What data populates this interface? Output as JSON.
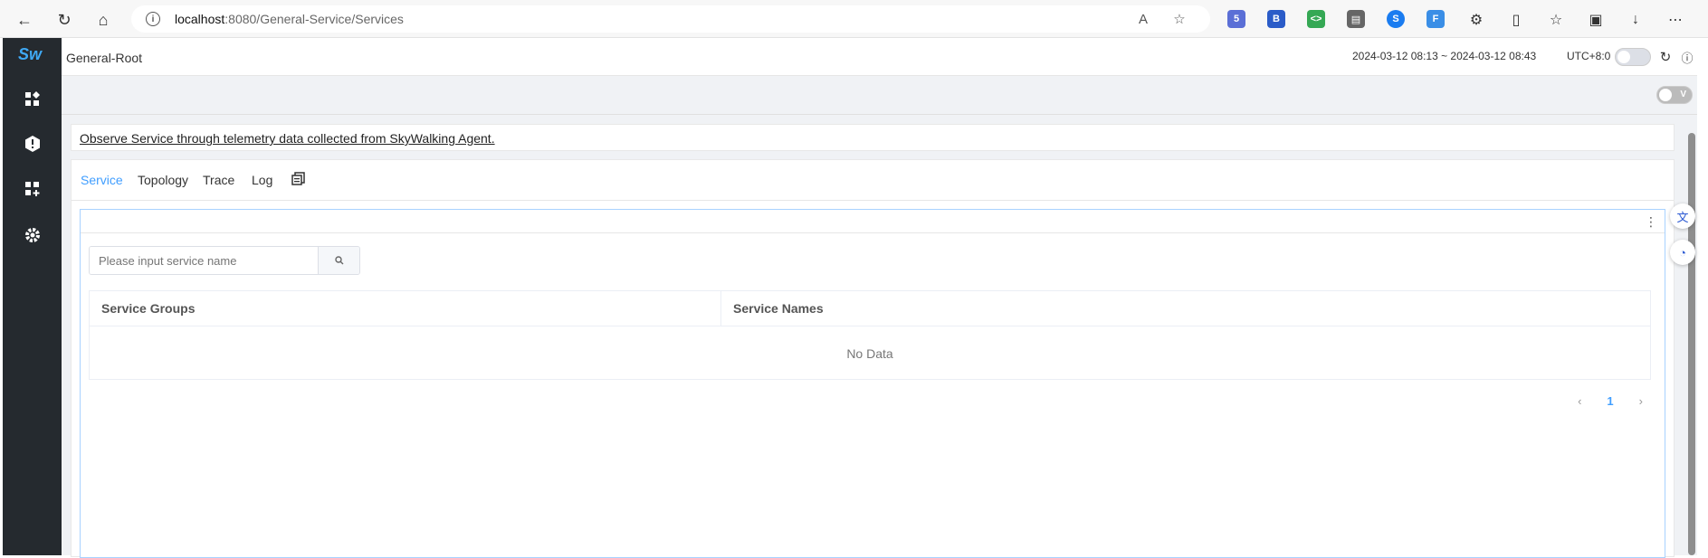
{
  "browser": {
    "url_host": "localhost",
    "url_rest": ":8080/General-Service/Services",
    "ext_badge": "5"
  },
  "app": {
    "logo": "Sw",
    "title": "General-Root",
    "time_range": "2024-03-12 08:13 ~ 2024-03-12 08:43",
    "utc": "UTC+8:0",
    "view_toggle_label": "V"
  },
  "sidebar": {
    "items": [
      {
        "icon": "dashboard-icon"
      },
      {
        "icon": "alert-icon"
      },
      {
        "icon": "add-widget-icon"
      },
      {
        "icon": "gear-icon"
      }
    ]
  },
  "description": "Observe Service through telemetry data collected from SkyWalking Agent.",
  "tabs": [
    {
      "label": "Service",
      "active": true
    },
    {
      "label": "Topology",
      "active": false
    },
    {
      "label": "Trace",
      "active": false
    },
    {
      "label": "Log",
      "active": false
    }
  ],
  "search": {
    "placeholder": "Please input service name"
  },
  "table": {
    "columns": [
      "Service Groups",
      "Service Names"
    ],
    "empty_text": "No Data"
  },
  "pagination": {
    "current": "1",
    "prev": "‹",
    "next": "›"
  },
  "colors": {
    "accent": "#409eff",
    "sidebar": "#252a2f"
  }
}
